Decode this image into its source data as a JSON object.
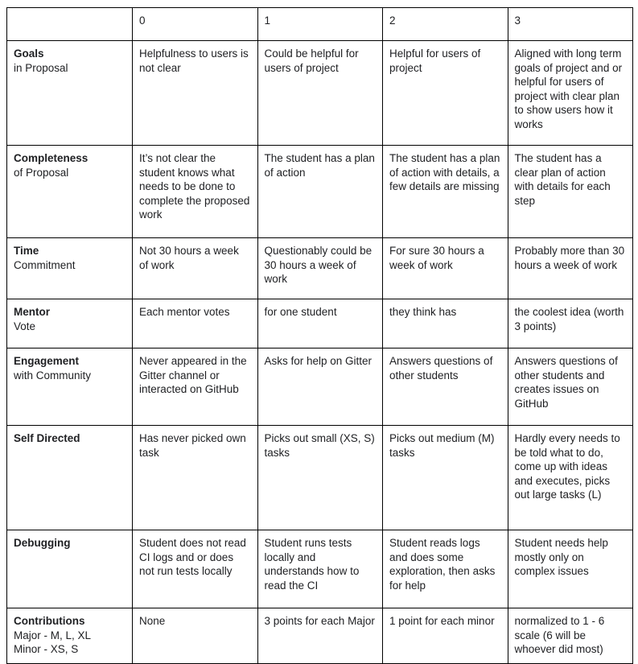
{
  "table": {
    "corner_label": "",
    "score_headers": [
      "0",
      "1",
      "2",
      "3"
    ],
    "rows": [
      {
        "criterion_title": "Goals",
        "criterion_sub": "in Proposal",
        "cells": [
          "Helpfulness to users is not clear",
          "Could be helpful for users of project",
          "Helpful for users of project",
          "Aligned with long term goals of project and or helpful for users of project with clear plan to show users how it works"
        ]
      },
      {
        "criterion_title": "Completeness",
        "criterion_sub": "of Proposal",
        "cells": [
          "It’s not clear the student knows what needs to be done to complete the proposed work",
          "The student has a plan of action",
          "The student has a plan of action with details, a few details are missing",
          "The student has a clear plan of action with details for each step"
        ]
      },
      {
        "criterion_title": "Time",
        "criterion_sub": "Commitment",
        "cells": [
          "Not 30 hours a week of work",
          "Questionably could be 30 hours a week of work",
          "For sure 30 hours a week of work",
          "Probably more than 30 hours a week of work"
        ]
      },
      {
        "criterion_title": "Mentor",
        "criterion_sub": "Vote",
        "cells": [
          "Each mentor votes",
          "for one student",
          "they think has",
          "the coolest idea (worth 3 points)"
        ]
      },
      {
        "criterion_title": "Engagement",
        "criterion_sub": "with Community",
        "cells": [
          "Never appeared in the Gitter channel or interacted on GitHub",
          "Asks for help on Gitter",
          "Answers questions of other students",
          "Answers questions of other students and creates issues on GitHub"
        ]
      },
      {
        "criterion_title": "Self Directed",
        "criterion_sub": "",
        "cells": [
          "Has never picked own task",
          "Picks out small (XS, S) tasks",
          "Picks out medium (M) tasks",
          "Hardly every needs to be told what to do, come up with ideas and executes, picks out large tasks (L)"
        ]
      },
      {
        "criterion_title": "Debugging",
        "criterion_sub": "",
        "cells": [
          "Student does not read CI logs and or does not run tests locally",
          "Student runs tests locally and understands how to read the CI",
          "Student reads logs and does some exploration, then asks for help",
          "Student needs help mostly only on complex issues"
        ]
      },
      {
        "criterion_title": "Contributions",
        "criterion_sub": "Major - M, L, XL\nMinor - XS, S",
        "cells": [
          "None",
          "3 points for each Major",
          "1 point for each minor",
          "normalized to 1 - 6 scale (6 will be whoever did most)"
        ]
      }
    ]
  },
  "colors": {
    "border": "#000000",
    "text": "#202124",
    "background": "#ffffff"
  }
}
